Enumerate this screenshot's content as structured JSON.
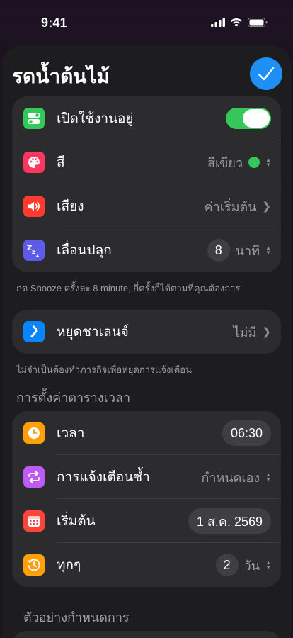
{
  "status": {
    "time": "9:41"
  },
  "title": "รดน้ำต้นไม้",
  "general": {
    "enabled_label": "เปิดใช้งานอยู่",
    "color_label": "สี",
    "color_value": "สีเขียว",
    "sound_label": "เสียง",
    "sound_value": "ค่าเริ่มต้น",
    "snooze_label": "เลื่อนปลุก",
    "snooze_value": "8",
    "snooze_unit": "นาที",
    "footnote": "กด Snooze ครั้งละ 8 minute, กี่ครั้งก็ได้ตามที่คุณต้องการ"
  },
  "stop": {
    "label": "หยุดชาเลนจ์",
    "value": "ไม่มี",
    "footnote": "ไม่จำเป็นต้องทำภารกิจเพื่อหยุดการแจ้งเตือน"
  },
  "schedule": {
    "section_title": "การตั้งค่าตารางเวลา",
    "time_label": "เวลา",
    "time_value": "06:30",
    "repeat_label": "การแจ้งเตือนซ้ำ",
    "repeat_value": "กำหนดเอง",
    "start_label": "เริ่มต้น",
    "start_value": "1 ส.ค. 2569",
    "every_label": "ทุกๆ",
    "every_value": "2",
    "every_unit": "วัน"
  },
  "preview": {
    "section_title": "ตัวอย่างกำหนดการ"
  },
  "colors": {
    "accent": "#1e8ff5",
    "toggle_on": "#34c759",
    "icon_enabled": "#34c759",
    "icon_color": "#ff375f",
    "icon_sound": "#ff3b30",
    "icon_snooze": "#5e5ce6",
    "icon_stop": "#0a84ff",
    "icon_time": "#ff9f0a",
    "icon_repeat": "#bf5af2",
    "icon_start": "#ff453a",
    "icon_every": "#ff9f0a"
  }
}
